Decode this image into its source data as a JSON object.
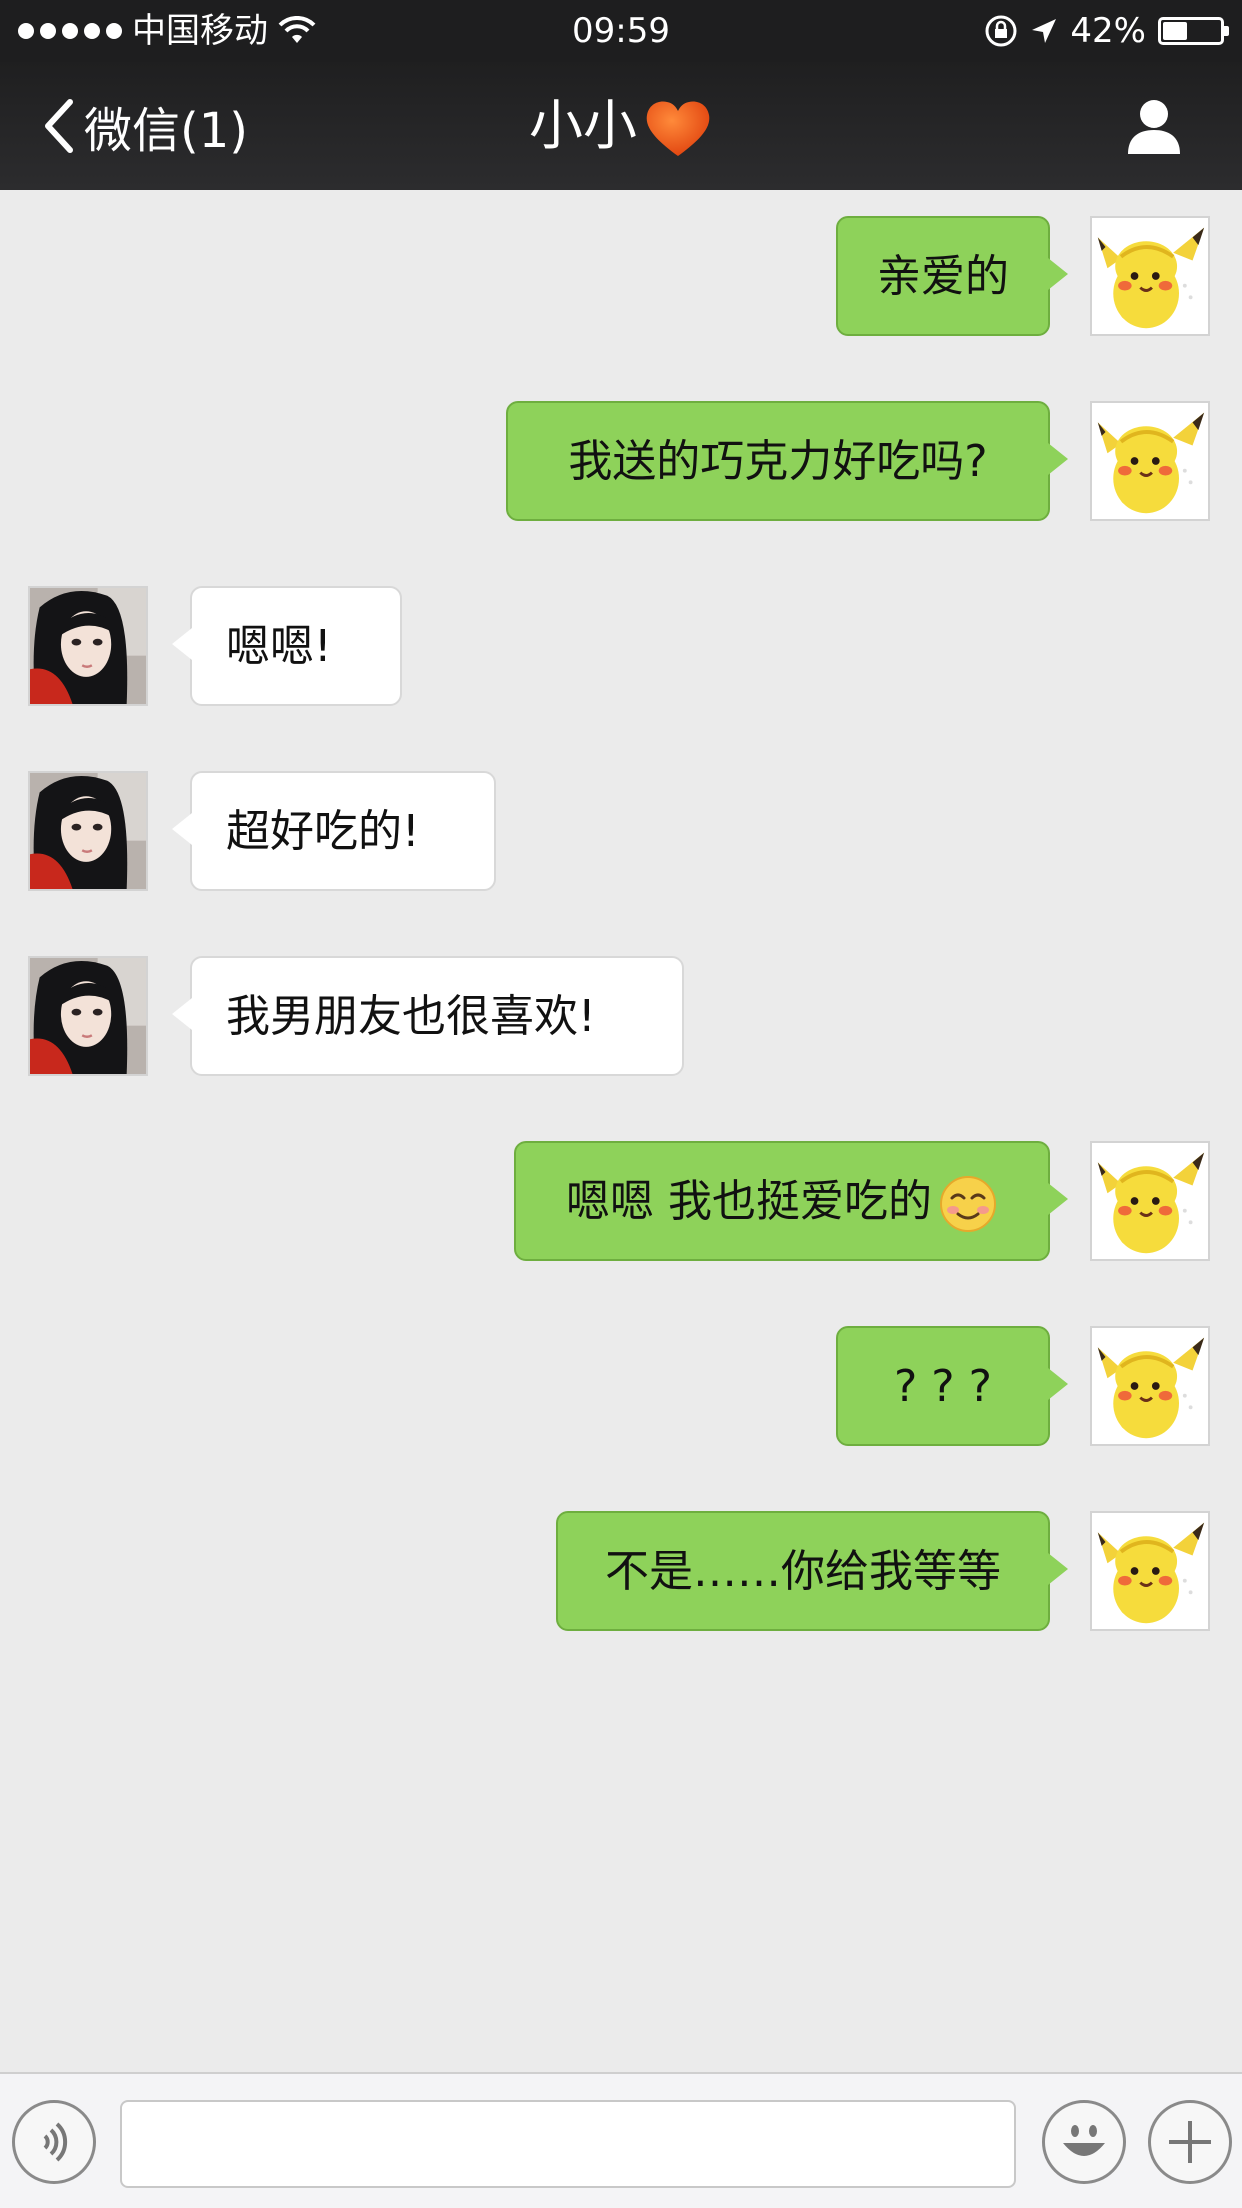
{
  "status_bar": {
    "carrier": "中国移动",
    "time": "09:59",
    "battery_percent": "42%",
    "battery_level": 0.42
  },
  "nav": {
    "back_label": "微信(1)",
    "title": "小小"
  },
  "messages": [
    {
      "from": "me",
      "text": "亲爱的"
    },
    {
      "from": "me",
      "text": "我送的巧克力好吃吗?"
    },
    {
      "from": "them",
      "text": "嗯嗯!"
    },
    {
      "from": "them",
      "text": "超好吃的!"
    },
    {
      "from": "them",
      "text": "我男朋友也很喜欢!"
    },
    {
      "from": "me",
      "text": "嗯嗯 我也挺爱吃的",
      "emoji": "smile-emoji"
    },
    {
      "from": "me",
      "text": "? ? ?"
    },
    {
      "from": "me",
      "text": "不是……你给我等等"
    }
  ],
  "input_bar": {
    "value": "",
    "placeholder": ""
  },
  "icons": {
    "back": "chevron-left-icon",
    "heart": "heart-icon",
    "profile": "person-icon",
    "voice": "voice-icon",
    "emoji": "emoji-icon",
    "add": "plus-icon"
  },
  "colors": {
    "nav_bg": "#1f1f20",
    "my_bubble": "#8ed25a",
    "their_bubble": "#ffffff",
    "chat_bg": "#ebebeb"
  }
}
